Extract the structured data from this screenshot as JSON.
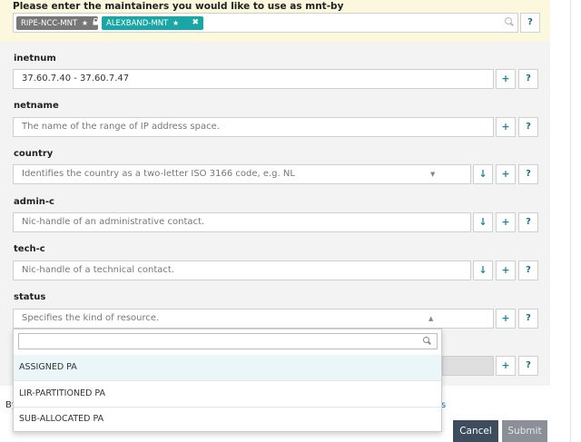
{
  "maintainers": {
    "title": "Please enter the maintainers you would like to use as mnt-by",
    "tags": [
      {
        "label": "RIPE-NCC-MNT",
        "icon": "star-icon",
        "lock": "lock-icon"
      },
      {
        "label": "ALEXBAND-MNT",
        "icon": "star-icon",
        "remove": "✖"
      }
    ],
    "help_label": "?"
  },
  "buttons": {
    "add_label": "+",
    "help_label": "?",
    "lookup_label": "↓"
  },
  "fields": {
    "inetnum": {
      "label": "inetnum",
      "value": "37.60.7.40 - 37.60.7.47"
    },
    "netname": {
      "label": "netname",
      "placeholder": "The name of the range of IP address space."
    },
    "country": {
      "label": "country",
      "placeholder": "Identifies the country as a two-letter ISO 3166 code, e.g. NL",
      "caret": "▼"
    },
    "admin_c": {
      "label": "admin-c",
      "placeholder": "Nic-handle of an administrative contact."
    },
    "tech_c": {
      "label": "tech-c",
      "placeholder": "Nic-handle of a technical contact."
    },
    "status": {
      "label": "status",
      "placeholder": "Specifies the kind of resource.",
      "caret": "▲"
    }
  },
  "status_dropdown": {
    "search_value": "",
    "options": [
      "ASSIGNED PA",
      "LIR-PARTITIONED PA",
      "SUB-ALLOCATED PA"
    ],
    "highlighted": "ASSIGNED PA"
  },
  "footer": {
    "text_fragment": "By",
    "link_fragment": "s",
    "cancel_label": "Cancel",
    "submit_label": "Submit"
  },
  "colors": {
    "accent": "#1aa6a4",
    "cancel_bg": "#3d4d5e",
    "submit_bg": "#8b9098",
    "maint_bg": "#fbf8de"
  }
}
